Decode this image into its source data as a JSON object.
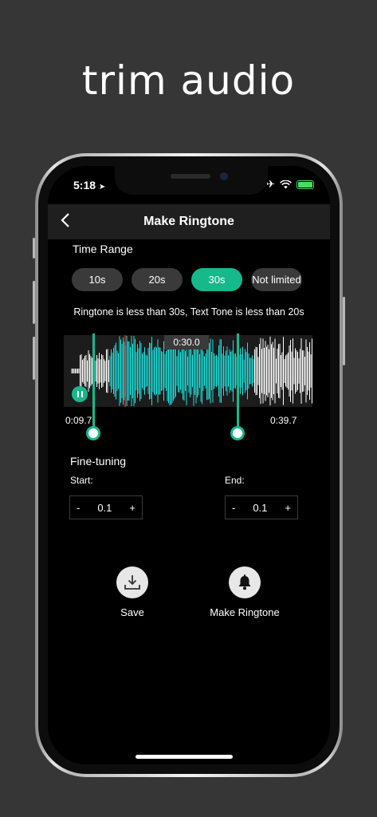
{
  "promo": {
    "title": "trim audio"
  },
  "status": {
    "time": "5:18"
  },
  "nav": {
    "title": "Make Ringtone"
  },
  "time_range": {
    "label": "Time Range",
    "options": [
      "10s",
      "20s",
      "30s",
      "Not limited"
    ],
    "selected": "30s"
  },
  "info": "Ringtone is less than 30s, Text Tone is less than 20s",
  "waveform": {
    "selection_duration": "0:30.0",
    "start_time": "0:09.7",
    "end_time": "0:39.7",
    "selection_color": "#1de0dc",
    "accent_color": "#16b98c",
    "playing": true
  },
  "fine_tuning": {
    "label": "Fine-tuning",
    "start": {
      "label": "Start:",
      "minus": "-",
      "value": "0.1",
      "plus": "+"
    },
    "end": {
      "label": "End:",
      "minus": "-",
      "value": "0.1",
      "plus": "+"
    }
  },
  "actions": {
    "save": {
      "label": "Save",
      "icon": "download-icon"
    },
    "make": {
      "label": "Make Ringtone",
      "icon": "bell-icon"
    }
  }
}
